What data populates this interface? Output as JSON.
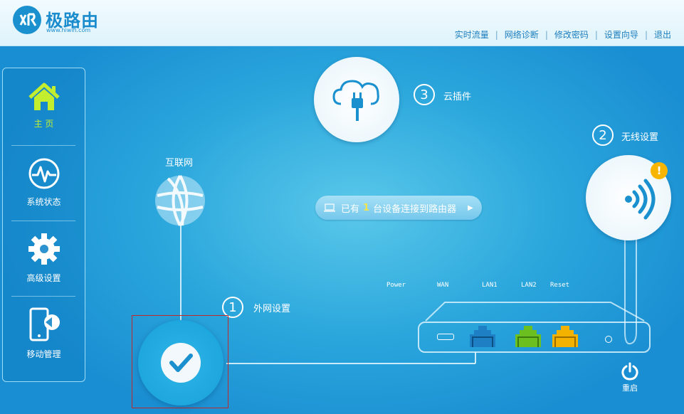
{
  "header": {
    "logo_text": "极路由",
    "logo_sub": "www.hiwifi.com",
    "nav": [
      "实时流量",
      "网络诊断",
      "修改密码",
      "设置向导",
      "退出"
    ]
  },
  "sidebar": {
    "items": [
      {
        "label": "主 页",
        "icon": "home-icon",
        "active": true
      },
      {
        "label": "系统状态",
        "icon": "pulse-icon",
        "active": false
      },
      {
        "label": "高级设置",
        "icon": "gear-icon",
        "active": false
      },
      {
        "label": "移动管理",
        "icon": "mobile-icon",
        "active": false
      }
    ]
  },
  "diagram": {
    "internet_label": "互联网",
    "wan_step": {
      "num": "1",
      "label": "外网设置"
    },
    "wireless_step": {
      "num": "2",
      "label": "无线设置"
    },
    "cloud_step": {
      "num": "3",
      "label": "云插件"
    },
    "devices": {
      "prefix": "已有",
      "count": "1",
      "suffix": "台设备连接到路由器"
    },
    "ports": [
      "Power",
      "WAN",
      "LAN1",
      "LAN2",
      "Reset"
    ],
    "reboot_label": "重启"
  },
  "colors": {
    "accent": "#1a90cf",
    "active_green": "#c3ee2f",
    "wan_port": "#1f7fc4",
    "lan1_port": "#6bbf1f",
    "lan2_port": "#f3b200",
    "alert": "#f7b500"
  }
}
